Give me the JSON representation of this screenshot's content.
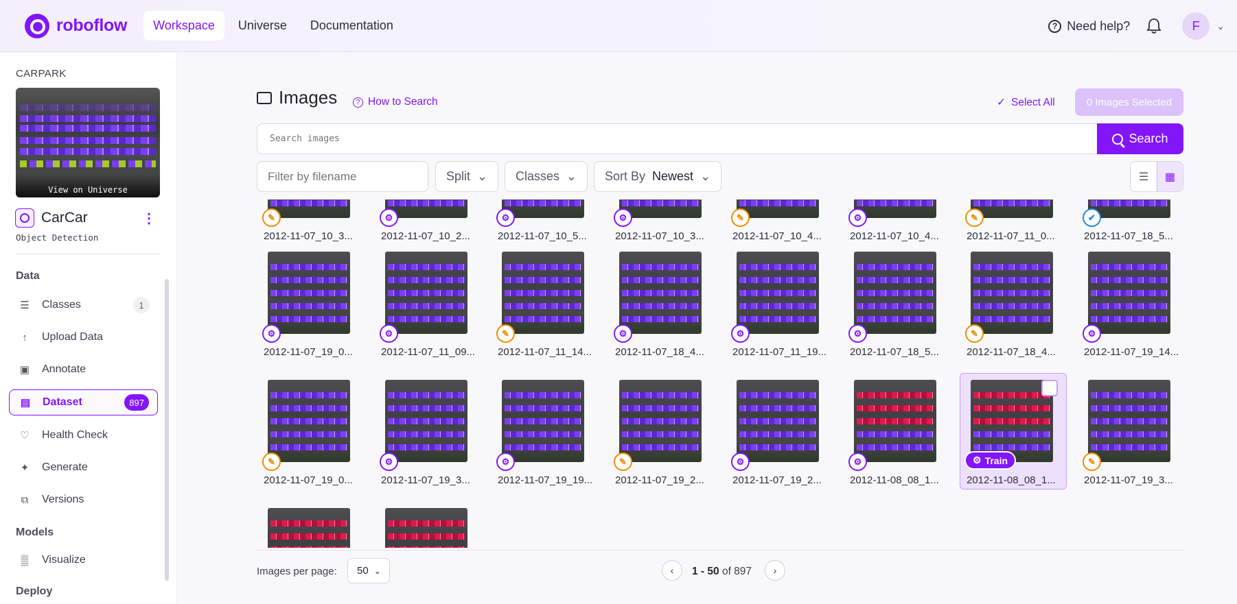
{
  "topbar": {
    "brand": "roboflow",
    "tabs": [
      "Workspace",
      "Universe",
      "Documentation"
    ],
    "help": "Need help?",
    "avatar_initial": "F"
  },
  "sidebar": {
    "workspace_label": "CARPARK",
    "thumb_label": "View on Universe",
    "project_name": "CarCar",
    "project_type": "Object Detection",
    "section_data": "Data",
    "section_models": "Models",
    "section_deploy": "Deploy",
    "items": [
      {
        "label": "Classes",
        "icon": "list-icon",
        "badge": "1"
      },
      {
        "label": "Upload Data",
        "icon": "upload-icon",
        "badge": ""
      },
      {
        "label": "Annotate",
        "icon": "annotate-icon",
        "badge": ""
      },
      {
        "label": "Dataset",
        "icon": "dataset-icon",
        "badge": "897"
      },
      {
        "label": "Health Check",
        "icon": "heart-icon",
        "badge": ""
      },
      {
        "label": "Generate",
        "icon": "generate-icon",
        "badge": ""
      },
      {
        "label": "Versions",
        "icon": "versions-icon",
        "badge": ""
      }
    ],
    "models_items": [
      {
        "label": "Visualize",
        "icon": "chart-icon"
      }
    ]
  },
  "main": {
    "title": "Images",
    "how_to_search": "How to Search",
    "select_all": "Select All",
    "selected": "0 Images Selected",
    "search_placeholder": "Search images",
    "search_button": "Search",
    "filter_placeholder": "Filter by filename",
    "split": "Split",
    "classes": "Classes",
    "sort_by": "Sort By",
    "sort_value": "Newest"
  },
  "images": [
    {
      "name": "2012-11-07_10_3...",
      "status": "annotate",
      "red": false
    },
    {
      "name": "2012-11-07_10_2...",
      "status": "train",
      "red": false
    },
    {
      "name": "2012-11-07_10_5...",
      "status": "train",
      "red": false
    },
    {
      "name": "2012-11-07_10_3...",
      "status": "train",
      "red": false
    },
    {
      "name": "2012-11-07_10_4...",
      "status": "annotate",
      "red": false
    },
    {
      "name": "2012-11-07_10_4...",
      "status": "train",
      "red": false
    },
    {
      "name": "2012-11-07_11_0...",
      "status": "annotate",
      "red": false
    },
    {
      "name": "2012-11-07_18_5...",
      "status": "valid",
      "red": false
    },
    {
      "name": "2012-11-07_19_0...",
      "status": "train",
      "red": false
    },
    {
      "name": "2012-11-07_11_09...",
      "status": "train",
      "red": false
    },
    {
      "name": "2012-11-07_11_14...",
      "status": "annotate",
      "red": false
    },
    {
      "name": "2012-11-07_18_4...",
      "status": "train",
      "red": false
    },
    {
      "name": "2012-11-07_11_19...",
      "status": "train",
      "red": false
    },
    {
      "name": "2012-11-07_18_5...",
      "status": "train",
      "red": false
    },
    {
      "name": "2012-11-07_18_4...",
      "status": "annotate",
      "red": false
    },
    {
      "name": "2012-11-07_19_14...",
      "status": "train",
      "red": false
    },
    {
      "name": "2012-11-07_19_0...",
      "status": "annotate",
      "red": false
    },
    {
      "name": "2012-11-07_19_3...",
      "status": "train",
      "red": false
    },
    {
      "name": "2012-11-07_19_19...",
      "status": "train",
      "red": false
    },
    {
      "name": "2012-11-07_19_2...",
      "status": "annotate",
      "red": false
    },
    {
      "name": "2012-11-07_19_2...",
      "status": "train",
      "red": false
    },
    {
      "name": "2012-11-08_08_1...",
      "status": "train",
      "red": true
    },
    {
      "name": "2012-11-08_08_1...",
      "status": "train",
      "red": true,
      "hover_label": "Train"
    },
    {
      "name": "2012-11-07_19_3...",
      "status": "annotate",
      "red": false
    },
    {
      "name": "",
      "status": "",
      "red": true
    },
    {
      "name": "",
      "status": "",
      "red": true
    }
  ],
  "pagination": {
    "per_page_label": "Images per page:",
    "per_page": "50",
    "range": "1 - 50",
    "of": "of 897"
  },
  "colors": {
    "accent": "#8315f9",
    "annotate": "#f08c00",
    "valid": "#1e88e5"
  }
}
